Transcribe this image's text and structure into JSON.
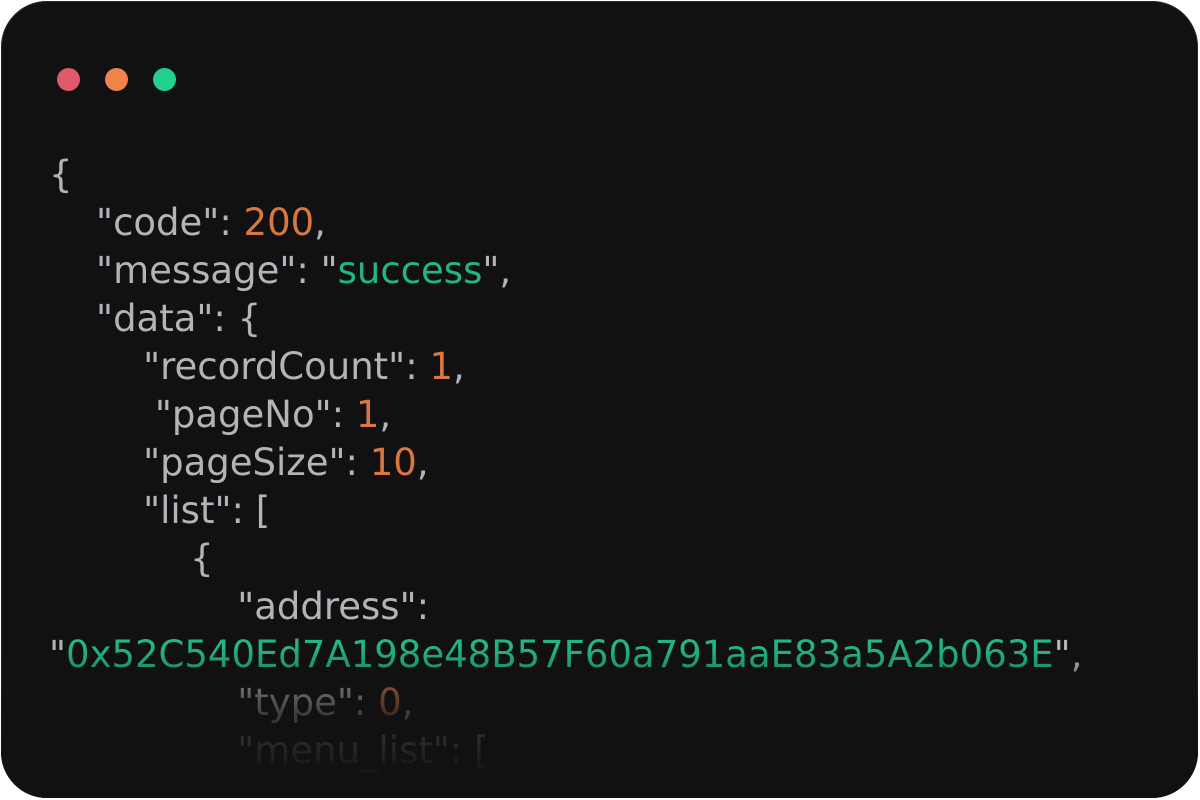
{
  "window": {
    "controls": [
      {
        "name": "close",
        "color": "#e05a6c"
      },
      {
        "name": "minimize",
        "color": "#f0824c"
      },
      {
        "name": "maximize",
        "color": "#22d08f"
      }
    ]
  },
  "code": {
    "lines": [
      {
        "indent": "",
        "parts": [
          {
            "t": "{",
            "c": "p"
          }
        ]
      },
      {
        "indent": "    ",
        "parts": [
          {
            "t": "\"code\": ",
            "c": "p"
          },
          {
            "t": "200",
            "c": "n"
          },
          {
            "t": ",",
            "c": "p"
          }
        ]
      },
      {
        "indent": "    ",
        "parts": [
          {
            "t": "\"message\": \"",
            "c": "p"
          },
          {
            "t": "success",
            "c": "s"
          },
          {
            "t": "\",",
            "c": "p"
          }
        ]
      },
      {
        "indent": "    ",
        "parts": [
          {
            "t": "\"data\": {",
            "c": "p"
          }
        ]
      },
      {
        "indent": "        ",
        "parts": [
          {
            "t": "\"recordCount\": ",
            "c": "p"
          },
          {
            "t": "1",
            "c": "n"
          },
          {
            "t": ",",
            "c": "p"
          }
        ]
      },
      {
        "indent": "         ",
        "parts": [
          {
            "t": "\"pageNo\": ",
            "c": "p"
          },
          {
            "t": "1",
            "c": "n"
          },
          {
            "t": ",",
            "c": "p"
          }
        ]
      },
      {
        "indent": "        ",
        "parts": [
          {
            "t": "\"pageSize\": ",
            "c": "p"
          },
          {
            "t": "10",
            "c": "n"
          },
          {
            "t": ",",
            "c": "p"
          }
        ]
      },
      {
        "indent": "        ",
        "parts": [
          {
            "t": "\"list\": [",
            "c": "p"
          }
        ]
      },
      {
        "indent": "            ",
        "parts": [
          {
            "t": "{",
            "c": "p"
          }
        ]
      },
      {
        "indent": "                ",
        "parts": [
          {
            "t": "\"address\":",
            "c": "p"
          }
        ]
      },
      {
        "indent": "",
        "parts": [
          {
            "t": "\"",
            "c": "p"
          },
          {
            "t": "0x52C540Ed7A198e48B57F60a791aaE83a5A2b063E",
            "c": "s"
          },
          {
            "t": "\",",
            "c": "p"
          }
        ]
      },
      {
        "indent": "                ",
        "parts": [
          {
            "t": "\"type\": ",
            "c": "p"
          },
          {
            "t": "0",
            "c": "n"
          },
          {
            "t": ",",
            "c": "p"
          }
        ]
      },
      {
        "indent": "                ",
        "parts": [
          {
            "t": "\"menu_list\": [",
            "c": "p"
          }
        ]
      }
    ]
  }
}
